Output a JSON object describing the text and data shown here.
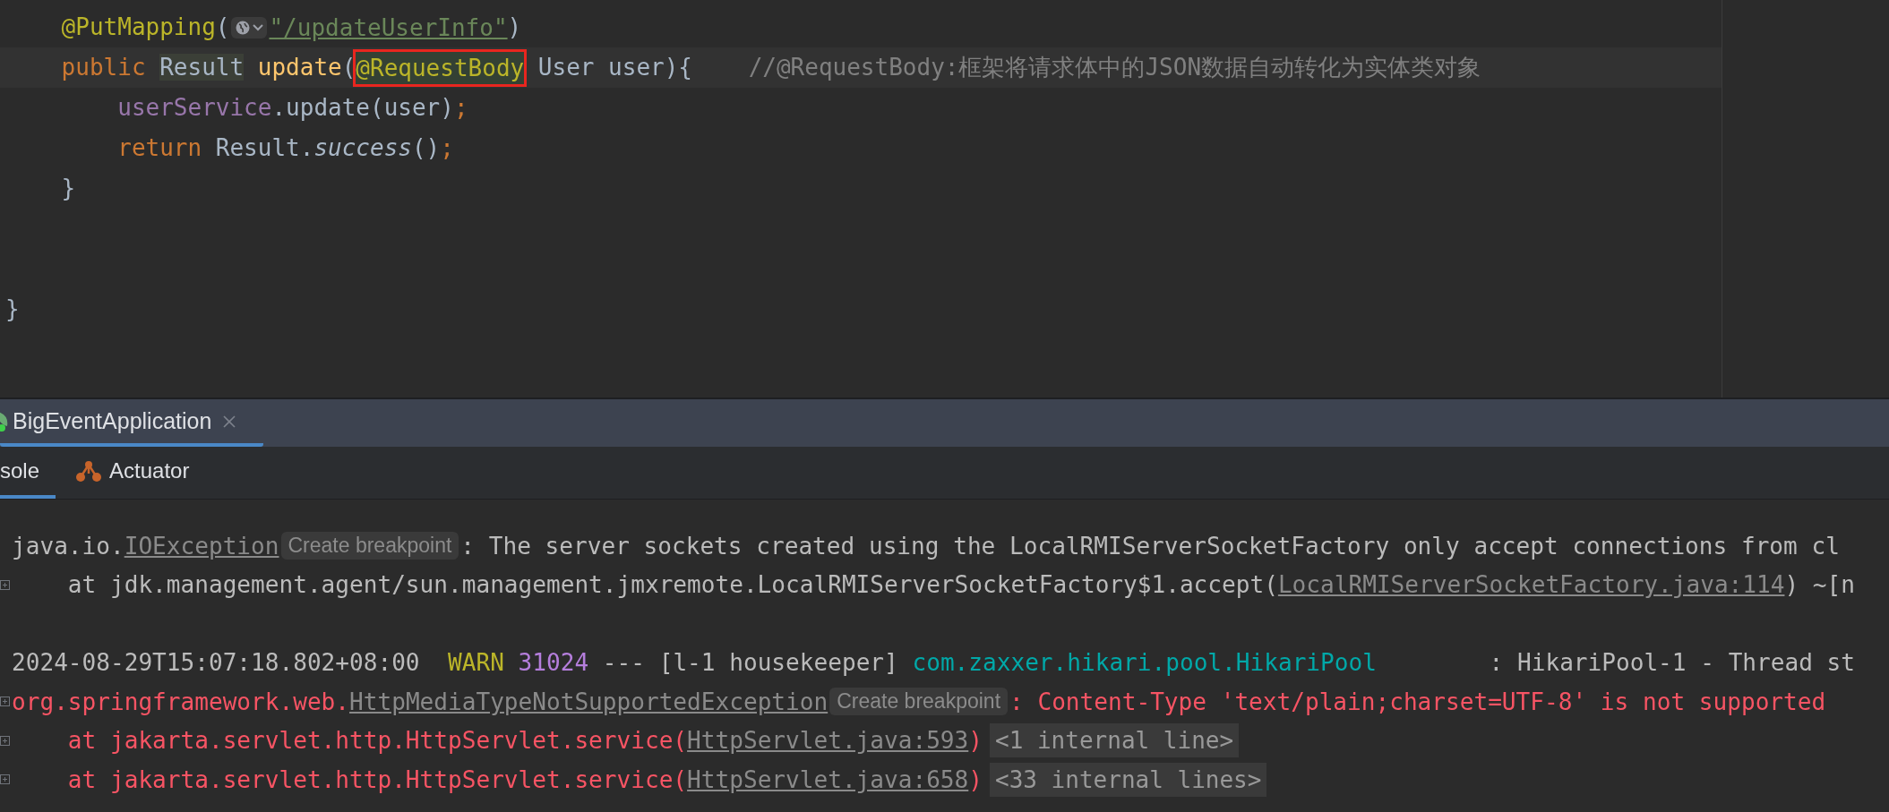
{
  "editor": {
    "lines": [
      {
        "kind": "code",
        "current": false,
        "tokens": [
          {
            "kind": "annotation",
            "text": "    @PutMapping"
          },
          {
            "kind": "plain",
            "text": "("
          },
          {
            "kind": "url_inlay"
          },
          {
            "kind": "string_link",
            "text": "\"/updateUserInfo\""
          },
          {
            "kind": "plain",
            "text": ")"
          }
        ]
      },
      {
        "kind": "code",
        "current": true,
        "tokens": [
          {
            "kind": "keyword",
            "text": "    public "
          },
          {
            "kind": "type_usage",
            "text": "Result"
          },
          {
            "kind": "method",
            "text": " update"
          },
          {
            "kind": "plain",
            "text": "("
          },
          {
            "kind": "boxed_annotation",
            "text": "@RequestBody"
          },
          {
            "kind": "plain",
            "text": " User user){    "
          },
          {
            "kind": "comment",
            "text": "//@RequestBody:框架将请求体中的JSON数据自动转化为实体类对象"
          }
        ]
      },
      {
        "kind": "code",
        "current": false,
        "tokens": [
          {
            "kind": "field",
            "text": "        userService"
          },
          {
            "kind": "plain",
            "text": ".update(user)"
          },
          {
            "kind": "keyword",
            "text": ";"
          }
        ]
      },
      {
        "kind": "code",
        "current": false,
        "tokens": [
          {
            "kind": "keyword",
            "text": "        return "
          },
          {
            "kind": "plain",
            "text": "Result."
          },
          {
            "kind": "italic",
            "text": "success"
          },
          {
            "kind": "plain",
            "text": "()"
          },
          {
            "kind": "keyword",
            "text": ";"
          }
        ]
      },
      {
        "kind": "code",
        "current": false,
        "tokens": [
          {
            "kind": "plain",
            "text": "    }"
          }
        ]
      },
      {
        "kind": "blank",
        "current": false
      },
      {
        "kind": "blank",
        "current": false
      },
      {
        "kind": "code",
        "current": false,
        "tokens": [
          {
            "kind": "plain",
            "text": "}"
          }
        ]
      }
    ]
  },
  "run_tabs": [
    {
      "label": "BigEventApplication",
      "selected": true,
      "kind": "spring"
    }
  ],
  "tool_tabs": [
    {
      "label": "sole",
      "selected": true,
      "kind": "console"
    },
    {
      "label": "Actuator",
      "selected": false,
      "kind": "actuator"
    }
  ],
  "console": {
    "lines": [
      {
        "kind": "text",
        "foldable": false,
        "tokens": [
          {
            "kind": "plain",
            "text": "java.io."
          },
          {
            "kind": "link",
            "text": "IOException"
          },
          {
            "kind": "chip",
            "text": "Create breakpoint"
          },
          {
            "kind": "plain",
            "text": ": The server sockets created using the LocalRMIServerSocketFactory only accept connections from cl"
          }
        ]
      },
      {
        "kind": "text",
        "foldable": true,
        "tokens": [
          {
            "kind": "plain",
            "text": "    at jdk.management.agent/sun.management.jmxremote.LocalRMIServerSocketFactory$1.accept("
          },
          {
            "kind": "link",
            "text": "LocalRMIServerSocketFactory.java:114"
          },
          {
            "kind": "plain",
            "text": ") ~[n"
          }
        ]
      },
      {
        "kind": "blank",
        "foldable": false
      },
      {
        "kind": "text",
        "foldable": false,
        "tokens": [
          {
            "kind": "plain",
            "text": "2024-08-29T15:07:18.802+08:00  "
          },
          {
            "kind": "warn",
            "text": "WARN "
          },
          {
            "kind": "pid",
            "text": "31024"
          },
          {
            "kind": "plain",
            "text": " --- [l-1 housekeeper] "
          },
          {
            "kind": "logger",
            "text": "com.zaxxer.hikari.pool.HikariPool"
          },
          {
            "kind": "plain",
            "text": "        : HikariPool-1 - Thread st"
          }
        ]
      },
      {
        "kind": "text",
        "foldable": true,
        "tokens": [
          {
            "kind": "error",
            "text": "org.springframework.web."
          },
          {
            "kind": "link",
            "text": "HttpMediaTypeNotSupportedException"
          },
          {
            "kind": "chip",
            "text": "Create breakpoint"
          },
          {
            "kind": "error",
            "text": ": Content-Type 'text/plain;charset=UTF-8' is not supported"
          }
        ]
      },
      {
        "kind": "text",
        "foldable": true,
        "tokens": [
          {
            "kind": "error",
            "text": "    at jakarta.servlet.http.HttpServlet.service("
          },
          {
            "kind": "link",
            "text": "HttpServlet.java:593"
          },
          {
            "kind": "error",
            "text": ")"
          },
          {
            "kind": "internal",
            "text": "<1 internal line>"
          }
        ]
      },
      {
        "kind": "text",
        "foldable": true,
        "tokens": [
          {
            "kind": "error",
            "text": "    at jakarta.servlet.http.HttpServlet.service("
          },
          {
            "kind": "link",
            "text": "HttpServlet.java:658"
          },
          {
            "kind": "error",
            "text": ")"
          },
          {
            "kind": "internal",
            "text": "<33 internal lines>"
          }
        ]
      }
    ]
  }
}
